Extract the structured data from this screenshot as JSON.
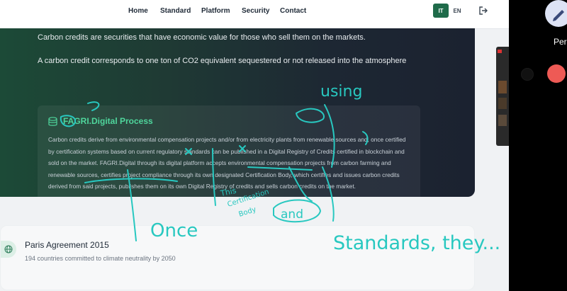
{
  "nav": {
    "links": [
      "Home",
      "Standard",
      "Platform",
      "Security",
      "Contact"
    ],
    "lang_it": "IT",
    "lang_en": "EN"
  },
  "hero": {
    "line1": "Carbon credits are securities that have economic value for those who sell them on the markets.",
    "line2": "A carbon credit corresponds to one ton of CO2 equivalent sequestered or not released into the atmosphere"
  },
  "process": {
    "title": "FAGRI.Digital Process",
    "body": "Carbon credits derive from environmental compensation projects and/or from electricity plants from renewable sources and, once certified by certification systems based on current regulatory standards can be published in a Digital Registry of Credits certified in blockchain and sold on the market. FAGRI.Digital through its digital platform accepts environmental compensation projects from carbon farming and renewable sources, certifies project compliance through its own designated Certification Body, which certifies and issues carbon credits derived from said projects, publishes them on its own Digital Registry of credits and sells carbon credits on the market."
  },
  "paris": {
    "title": "Paris Agreement 2015",
    "subtitle": "194 countries committed to climate neutrality by 2050"
  },
  "side_panel": {
    "pen_label": "Per"
  },
  "annotations": {
    "using": "using",
    "once": "Once",
    "this_cert_body_1": "This",
    "this_cert_body_2": "Certification",
    "this_cert_body_3": "Body",
    "and": "and",
    "standards": "Standards, they..."
  },
  "colors": {
    "accent": "#1f6b4a",
    "process_title": "#4fd69c",
    "ink": "#28c8c0",
    "record_red": "#ee5a55"
  }
}
